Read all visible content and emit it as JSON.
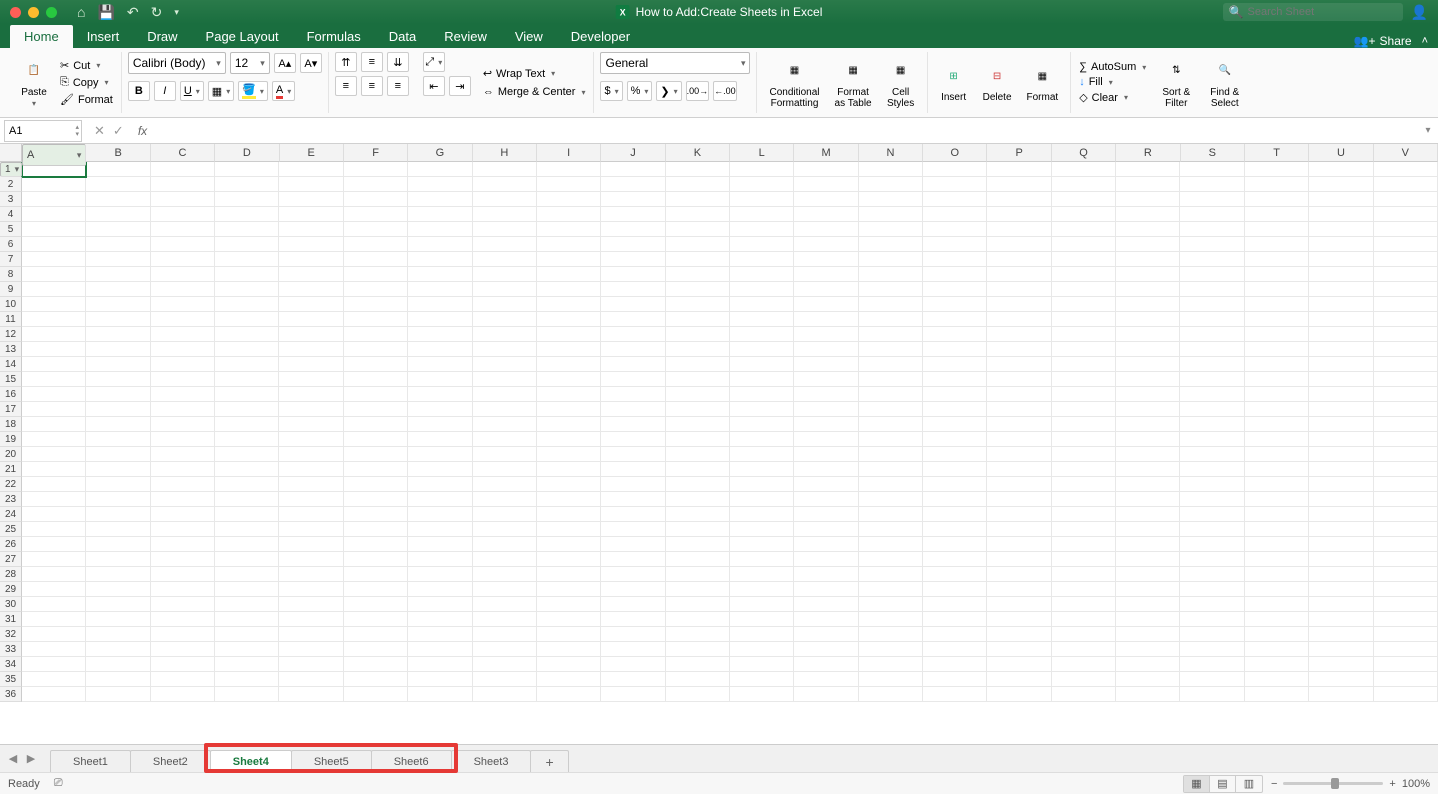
{
  "window": {
    "title": "How to Add:Create Sheets in Excel",
    "search_placeholder": "Search Sheet"
  },
  "tabs": {
    "items": [
      "Home",
      "Insert",
      "Draw",
      "Page Layout",
      "Formulas",
      "Data",
      "Review",
      "View",
      "Developer"
    ],
    "active": "Home",
    "share": "Share"
  },
  "ribbon": {
    "clipboard": {
      "paste": "Paste",
      "cut": "Cut",
      "copy": "Copy",
      "format": "Format"
    },
    "font": {
      "name": "Calibri (Body)",
      "size": "12"
    },
    "alignment": {
      "wrap": "Wrap Text",
      "merge": "Merge & Center"
    },
    "number": {
      "format": "General"
    },
    "cond_fmt": "Conditional\nFormatting",
    "fmt_table": "Format\nas Table",
    "cell_styles": "Cell\nStyles",
    "insert": "Insert",
    "delete": "Delete",
    "format_cell": "Format",
    "autosum": "AutoSum",
    "fill": "Fill",
    "clear": "Clear",
    "sort_filter": "Sort &\nFilter",
    "find_select": "Find &\nSelect"
  },
  "formula_bar": {
    "name_box": "A1",
    "fx": "fx"
  },
  "grid": {
    "columns": [
      "A",
      "B",
      "C",
      "D",
      "E",
      "F",
      "G",
      "H",
      "I",
      "J",
      "K",
      "L",
      "M",
      "N",
      "O",
      "P",
      "Q",
      "R",
      "S",
      "T",
      "U",
      "V"
    ],
    "rows": 36,
    "active_cell": "A1"
  },
  "sheets": {
    "items": [
      "Sheet1",
      "Sheet2",
      "Sheet4",
      "Sheet5",
      "Sheet6",
      "Sheet3"
    ],
    "active": "Sheet4",
    "highlighted": [
      "Sheet4",
      "Sheet5",
      "Sheet6"
    ]
  },
  "status": {
    "ready": "Ready",
    "zoom": "100%"
  }
}
